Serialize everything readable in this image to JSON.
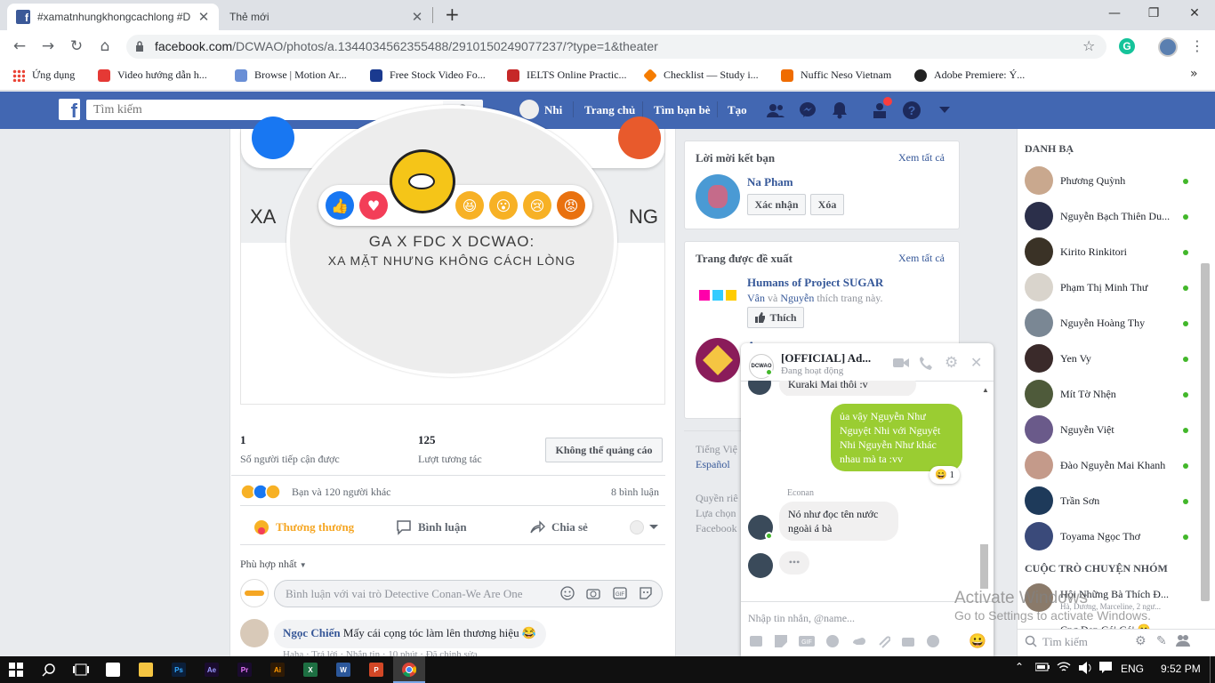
{
  "browser": {
    "tabs": [
      {
        "title": "#xamatnhungkhongcachlong #D",
        "close": "✕"
      },
      {
        "title": "Thẻ mới",
        "close": "✕"
      }
    ],
    "new_tab": "+",
    "window": {
      "min": "—",
      "max": "❐",
      "close": "✕"
    },
    "url_host": "facebook.com",
    "url_path": "/DCWAO/photos/a.1344034562355488/2910150249077237/?type=1&theater",
    "bookmarks": [
      {
        "label": "Ứng dụng",
        "color": "#ea4335"
      },
      {
        "label": "Video hướng dẫn h...",
        "color": "#e53935"
      },
      {
        "label": "Browse | Motion Ar...",
        "color": "#6a8fd6"
      },
      {
        "label": "Free Stock Video Fo...",
        "color": "#1a3a8f"
      },
      {
        "label": "IELTS Online Practic...",
        "color": "#c62828"
      },
      {
        "label": "Checklist — Study i...",
        "color": "#f57c00"
      },
      {
        "label": "Nuffic Neso Vietnam",
        "color": "#ef6c00"
      },
      {
        "label": "Adobe Premiere: Ý...",
        "color": "#222222"
      }
    ],
    "more": "»"
  },
  "fb": {
    "logo": "f",
    "search_placeholder": "Tìm kiếm",
    "nav": {
      "profile": "Nhi",
      "home": "Trang chủ",
      "find_friends": "Tìm bạn bè",
      "create": "Tạo"
    },
    "brand_color": "#4267b2"
  },
  "post": {
    "banner_left": "XA",
    "banner_right": "NG",
    "headline1": "GA X FDC X DCWAO:",
    "headline2": "XA MẶT NHƯNG KHÔNG CÁCH LÒNG",
    "reach_num": "1",
    "reach_label": "Số người tiếp cận được",
    "engage_num": "125",
    "engage_label": "Lượt tương tác",
    "no_ad_button": "Không thể quảng cáo",
    "reactions_text": "Bạn và 120 người khác",
    "comments_count": "8 bình luận",
    "actions": {
      "react": "Thương thương",
      "comment": "Bình luận",
      "share": "Chia sẻ"
    },
    "sort": "Phù hợp nhất",
    "comment_placeholder": "Bình luận với vai trò Detective Conan-We Are One",
    "comment": {
      "author": "Ngọc Chiến",
      "text": "Mấy cái cọng tóc làm lên thương hiệu 😂",
      "meta": "Haha · Trả lời · Nhắn tin · 10 phút · Đã chỉnh sửa"
    }
  },
  "friend_requests": {
    "title": "Lời mời kết bạn",
    "see_all": "Xem tất cả",
    "name": "Na Pham",
    "confirm": "Xác nhận",
    "delete": "Xóa"
  },
  "suggested_pages": {
    "title": "Trang được đề xuất",
    "see_all": "Xem tất cả",
    "page_name": "Humans of Project SUGAR",
    "liked_by_1": "Vân",
    "liked_by_2": "Nguyễn",
    "liked_connector": "và",
    "liked_suffix": "thích trang này.",
    "like": "Thích",
    "second_page": "A"
  },
  "languages": {
    "current": "Tiếng Việ",
    "other": "Español"
  },
  "footer": {
    "line1": "Quyền riê",
    "line2": "Lựa chọn",
    "line3": "Facebook"
  },
  "contacts": {
    "header": "DANH BẠ",
    "items": [
      {
        "name": "Phương Quỳnh",
        "color": "#c9a88e"
      },
      {
        "name": "Nguyễn Bạch Thiên Du...",
        "color": "#2b2f4a"
      },
      {
        "name": "Kirito Rinkitori",
        "color": "#3a3226"
      },
      {
        "name": "Phạm Thị Minh Thư",
        "color": "#d9d4cc"
      },
      {
        "name": "Nguyễn Hoàng Thy",
        "color": "#7a8794"
      },
      {
        "name": "Yen Vy",
        "color": "#3a2a2a"
      },
      {
        "name": "Mít Tờ Nhện",
        "color": "#4e5a3a"
      },
      {
        "name": "Nguyễn Việt",
        "color": "#6a5a8a"
      },
      {
        "name": "Đào Nguyễn Mai Khanh",
        "color": "#c49a8a"
      },
      {
        "name": "Trần Sơn",
        "color": "#1e3a5a"
      },
      {
        "name": "Toyama Ngọc Thơ",
        "color": "#3a4a7a"
      }
    ],
    "group_header": "CUỘC TRÒ CHUYỆN NHÓM",
    "group_name": "Hội Những Bà Thích Đ...",
    "group_sub": "Hà, Dương, Marceline, 2 ngư...",
    "group_name2": "Cng Đẹp Gái Gái 😊",
    "search": "Tìm kiếm",
    "status_color": "#42b72a"
  },
  "chat": {
    "title": "[OFFICIAL] Ad...",
    "status": "Đang hoạt động",
    "prev_msg": "Kuraki Mai thôi :v",
    "my_msg": "ủa vậy Nguyễn Như Nguyệt Nhi với Nguyệt Nhi Nguyễn Như khác nhau mà ta :vv",
    "my_reaction": "😄 1",
    "sender": "Econan",
    "their_msg": "Nó như đọc tên nước ngoài á bà",
    "typing": "•••",
    "input_placeholder": "Nhập tin nhắn, @name...",
    "bubble_color": "#9acd32",
    "emoji": "😀"
  },
  "watermark": {
    "line1": "Activate Windows",
    "line2": "Go to Settings to activate Windows."
  },
  "taskbar": {
    "lang": "ENG",
    "time": "9:52 PM"
  }
}
